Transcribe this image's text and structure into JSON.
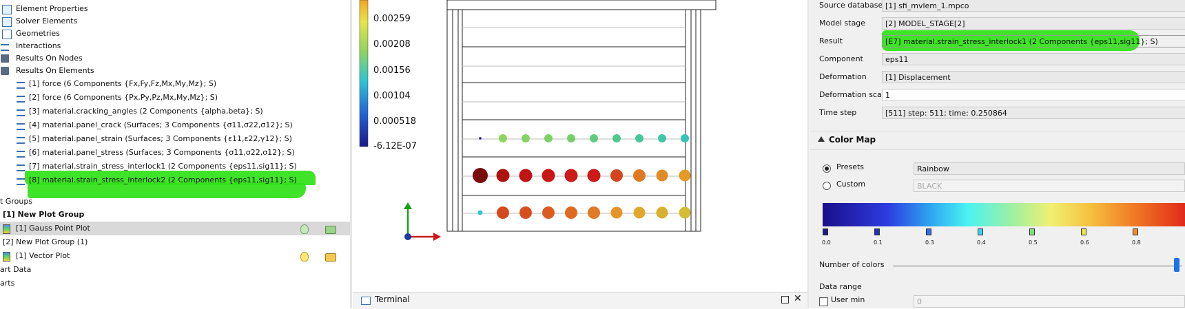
{
  "tree": {
    "items": [
      {
        "label": "Element Properties",
        "icon": "element-properties-icon"
      },
      {
        "label": "Solver Elements",
        "icon": "solver-elements-icon"
      },
      {
        "label": "Geometries",
        "icon": "geometries-icon"
      },
      {
        "label": "Interactions",
        "icon": "interactions-icon"
      },
      {
        "label": "Results On Nodes",
        "icon": "folder-icon"
      },
      {
        "label": "Results On Elements",
        "icon": "folder-icon"
      }
    ],
    "results": [
      "[1] force (6 Components {Fx,Fy,Fz,Mx,My,Mz}; S)",
      "[2] force (6 Components {Px,Py,Pz,Mx,My,Mz}; S)",
      "[3] material.cracking_angles (2 Components {alpha,beta}; S)",
      "[4] material.panel_crack (Surfaces; 3 Components {σ11,σ22,σ12}; S)",
      "[5] material.panel_strain (Surfaces; 3 Components {ε11,ε22,γ12}; S)",
      "[6] material.panel_stress (Surfaces; 3 Components {σ11,σ22,σ12}; S)",
      "[7] material.strain_stress_interlock1 (2 Components {eps11,sig11}; S)",
      "[8] material.strain_stress_interlock2 (2 Components {eps11,sig11}; S)"
    ],
    "plot_groups_label": "t Groups",
    "group1_label": "[1] New Plot Group",
    "gauss_label": "[1] Gauss Point Plot",
    "group2_label": "[2] New Plot Group (1)",
    "vector_label": "[1] Vector Plot",
    "chart_data_label": "art Data",
    "charts_label": "arts"
  },
  "legend": {
    "ticks": [
      "0.00259",
      "0.00208",
      "0.00156",
      "0.00104",
      "0.000518",
      "-6.12E-07"
    ]
  },
  "terminal": {
    "label": "Terminal"
  },
  "props": {
    "source_database": {
      "label": "Source database",
      "value": "[1] sfi_mvlem_1.mpco"
    },
    "model_stage": {
      "label": "Model stage",
      "value": "[2] MODEL_STAGE[2]"
    },
    "result": {
      "label": "Result",
      "value": "[E7] material.strain_stress_interlock1 (2 Components {eps11,sig11}; S)"
    },
    "component": {
      "label": "Component",
      "value": "eps11"
    },
    "deformation": {
      "label": "Deformation",
      "value": "[1] Displacement"
    },
    "deformation_scale": {
      "label": "Deformation scale",
      "value": "1"
    },
    "time_step": {
      "label": "Time step",
      "value": "[511] step: 511; time: 0.250864"
    }
  },
  "colormap": {
    "section_label": "Color Map",
    "presets_label": "Presets",
    "presets_value": "Rainbow",
    "custom_label": "Custom",
    "custom_value": "BLACK",
    "ticks": [
      "0.0",
      "0.1",
      "0.3",
      "0.4",
      "0.5",
      "0.6",
      "0.8"
    ],
    "tick_colors": [
      "#1d1a8c",
      "#1f2fb8",
      "#2b6fe0",
      "#3fd0e2",
      "#7ee07a",
      "#e8e849",
      "#f08a30"
    ],
    "number_of_colors_label": "Number of colors",
    "data_range_label": "Data range",
    "user_min_label": "User min",
    "user_min_value": "0"
  }
}
